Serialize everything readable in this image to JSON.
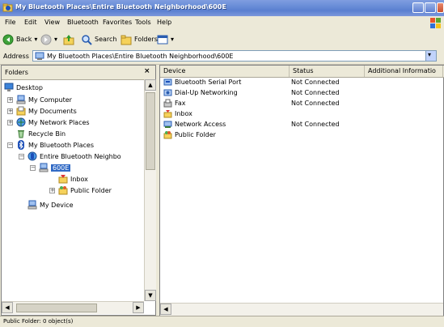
{
  "window": {
    "title": "My Bluetooth Places\\Entire Bluetooth Neighborhood\\600E"
  },
  "menu": {
    "items": [
      "File",
      "Edit",
      "View",
      "Bluetooth",
      "Favorites",
      "Tools",
      "Help"
    ]
  },
  "toolbar": {
    "back_label": "Back",
    "search_label": "Search",
    "folders_label": "Folders"
  },
  "address": {
    "label": "Address",
    "value": "My Bluetooth Places\\Entire Bluetooth Neighborhood\\600E"
  },
  "folders_pane": {
    "title": "Folders",
    "close": "×",
    "tree": [
      {
        "label": "Desktop",
        "icon": "desktop-icon"
      },
      {
        "label": "My Computer",
        "icon": "computer-icon"
      },
      {
        "label": "My Documents",
        "icon": "documents-icon"
      },
      {
        "label": "My Network Places",
        "icon": "network-places-icon"
      },
      {
        "label": "Recycle Bin",
        "icon": "recycle-bin-icon"
      },
      {
        "label": "My Bluetooth Places",
        "icon": "bluetooth-icon"
      },
      {
        "label": "Entire Bluetooth Neighbo",
        "icon": "bluetooth-neighborhood-icon"
      },
      {
        "label": "600E",
        "icon": "computer-icon"
      },
      {
        "label": "Inbox",
        "icon": "inbox-icon"
      },
      {
        "label": "Public Folder",
        "icon": "public-folder-icon"
      },
      {
        "label": "My Device",
        "icon": "device-icon"
      }
    ]
  },
  "content": {
    "columns": [
      "Device",
      "Status",
      "Additional Informatio"
    ],
    "rows": [
      {
        "name": "Bluetooth Serial Port",
        "status": "Not Connected",
        "icon": "serial-port-icon"
      },
      {
        "name": "Dial-Up Networking",
        "status": "Not Connected",
        "icon": "dialup-icon"
      },
      {
        "name": "Fax",
        "status": "Not Connected",
        "icon": "fax-icon"
      },
      {
        "name": "Inbox",
        "status": "",
        "icon": "inbox-icon"
      },
      {
        "name": "Network Access",
        "status": "Not Connected",
        "icon": "network-access-icon"
      },
      {
        "name": "Public Folder",
        "status": "",
        "icon": "public-folder-icon"
      }
    ]
  },
  "statusbar": {
    "text": "Public Folder: 0 object(s)"
  },
  "colors": {
    "titlebar": "#6b8fd8",
    "selection": "#316ac5",
    "chrome": "#ece9d8"
  }
}
